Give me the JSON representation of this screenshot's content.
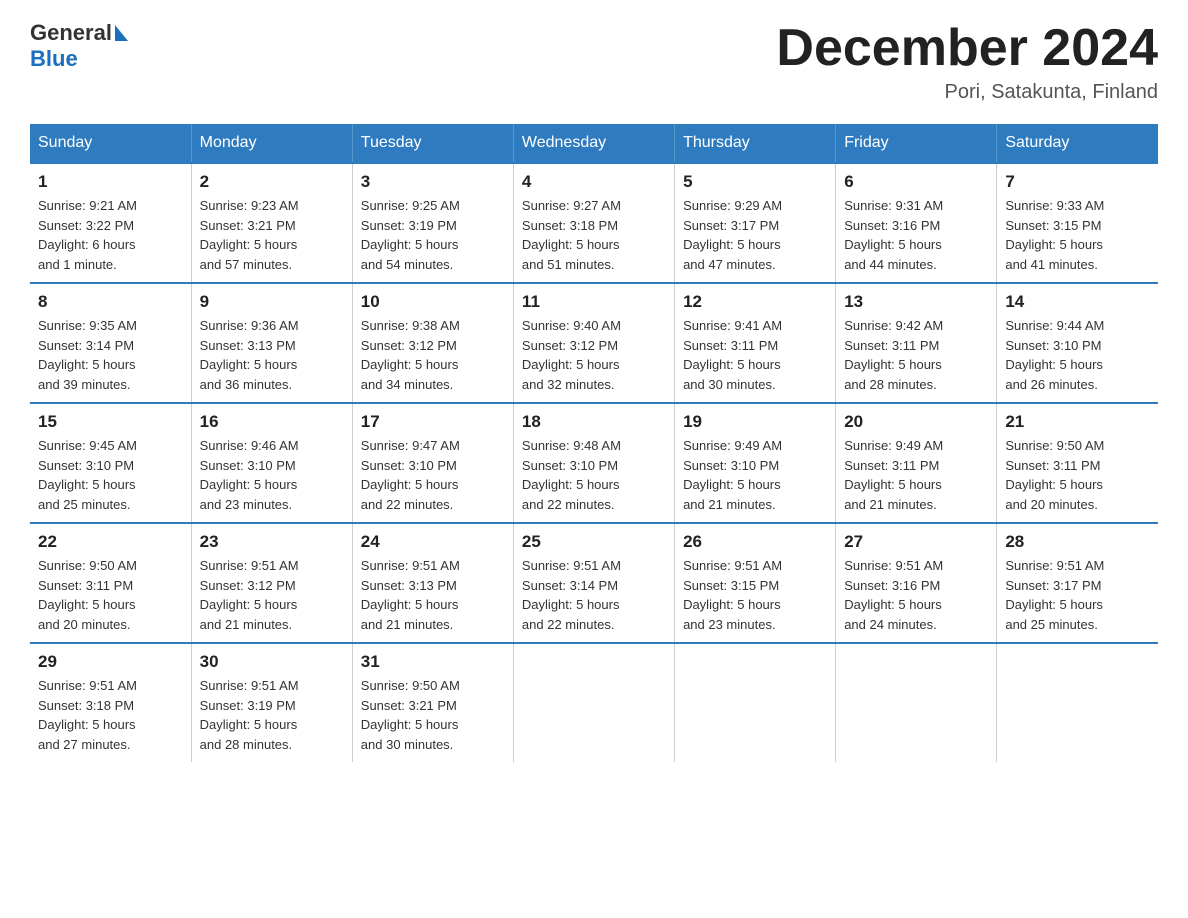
{
  "header": {
    "title": "December 2024",
    "location": "Pori, Satakunta, Finland",
    "logo_general": "General",
    "logo_blue": "Blue"
  },
  "days_of_week": [
    "Sunday",
    "Monday",
    "Tuesday",
    "Wednesday",
    "Thursday",
    "Friday",
    "Saturday"
  ],
  "weeks": [
    [
      {
        "day": "1",
        "info": "Sunrise: 9:21 AM\nSunset: 3:22 PM\nDaylight: 6 hours\nand 1 minute."
      },
      {
        "day": "2",
        "info": "Sunrise: 9:23 AM\nSunset: 3:21 PM\nDaylight: 5 hours\nand 57 minutes."
      },
      {
        "day": "3",
        "info": "Sunrise: 9:25 AM\nSunset: 3:19 PM\nDaylight: 5 hours\nand 54 minutes."
      },
      {
        "day": "4",
        "info": "Sunrise: 9:27 AM\nSunset: 3:18 PM\nDaylight: 5 hours\nand 51 minutes."
      },
      {
        "day": "5",
        "info": "Sunrise: 9:29 AM\nSunset: 3:17 PM\nDaylight: 5 hours\nand 47 minutes."
      },
      {
        "day": "6",
        "info": "Sunrise: 9:31 AM\nSunset: 3:16 PM\nDaylight: 5 hours\nand 44 minutes."
      },
      {
        "day": "7",
        "info": "Sunrise: 9:33 AM\nSunset: 3:15 PM\nDaylight: 5 hours\nand 41 minutes."
      }
    ],
    [
      {
        "day": "8",
        "info": "Sunrise: 9:35 AM\nSunset: 3:14 PM\nDaylight: 5 hours\nand 39 minutes."
      },
      {
        "day": "9",
        "info": "Sunrise: 9:36 AM\nSunset: 3:13 PM\nDaylight: 5 hours\nand 36 minutes."
      },
      {
        "day": "10",
        "info": "Sunrise: 9:38 AM\nSunset: 3:12 PM\nDaylight: 5 hours\nand 34 minutes."
      },
      {
        "day": "11",
        "info": "Sunrise: 9:40 AM\nSunset: 3:12 PM\nDaylight: 5 hours\nand 32 minutes."
      },
      {
        "day": "12",
        "info": "Sunrise: 9:41 AM\nSunset: 3:11 PM\nDaylight: 5 hours\nand 30 minutes."
      },
      {
        "day": "13",
        "info": "Sunrise: 9:42 AM\nSunset: 3:11 PM\nDaylight: 5 hours\nand 28 minutes."
      },
      {
        "day": "14",
        "info": "Sunrise: 9:44 AM\nSunset: 3:10 PM\nDaylight: 5 hours\nand 26 minutes."
      }
    ],
    [
      {
        "day": "15",
        "info": "Sunrise: 9:45 AM\nSunset: 3:10 PM\nDaylight: 5 hours\nand 25 minutes."
      },
      {
        "day": "16",
        "info": "Sunrise: 9:46 AM\nSunset: 3:10 PM\nDaylight: 5 hours\nand 23 minutes."
      },
      {
        "day": "17",
        "info": "Sunrise: 9:47 AM\nSunset: 3:10 PM\nDaylight: 5 hours\nand 22 minutes."
      },
      {
        "day": "18",
        "info": "Sunrise: 9:48 AM\nSunset: 3:10 PM\nDaylight: 5 hours\nand 22 minutes."
      },
      {
        "day": "19",
        "info": "Sunrise: 9:49 AM\nSunset: 3:10 PM\nDaylight: 5 hours\nand 21 minutes."
      },
      {
        "day": "20",
        "info": "Sunrise: 9:49 AM\nSunset: 3:11 PM\nDaylight: 5 hours\nand 21 minutes."
      },
      {
        "day": "21",
        "info": "Sunrise: 9:50 AM\nSunset: 3:11 PM\nDaylight: 5 hours\nand 20 minutes."
      }
    ],
    [
      {
        "day": "22",
        "info": "Sunrise: 9:50 AM\nSunset: 3:11 PM\nDaylight: 5 hours\nand 20 minutes."
      },
      {
        "day": "23",
        "info": "Sunrise: 9:51 AM\nSunset: 3:12 PM\nDaylight: 5 hours\nand 21 minutes."
      },
      {
        "day": "24",
        "info": "Sunrise: 9:51 AM\nSunset: 3:13 PM\nDaylight: 5 hours\nand 21 minutes."
      },
      {
        "day": "25",
        "info": "Sunrise: 9:51 AM\nSunset: 3:14 PM\nDaylight: 5 hours\nand 22 minutes."
      },
      {
        "day": "26",
        "info": "Sunrise: 9:51 AM\nSunset: 3:15 PM\nDaylight: 5 hours\nand 23 minutes."
      },
      {
        "day": "27",
        "info": "Sunrise: 9:51 AM\nSunset: 3:16 PM\nDaylight: 5 hours\nand 24 minutes."
      },
      {
        "day": "28",
        "info": "Sunrise: 9:51 AM\nSunset: 3:17 PM\nDaylight: 5 hours\nand 25 minutes."
      }
    ],
    [
      {
        "day": "29",
        "info": "Sunrise: 9:51 AM\nSunset: 3:18 PM\nDaylight: 5 hours\nand 27 minutes."
      },
      {
        "day": "30",
        "info": "Sunrise: 9:51 AM\nSunset: 3:19 PM\nDaylight: 5 hours\nand 28 minutes."
      },
      {
        "day": "31",
        "info": "Sunrise: 9:50 AM\nSunset: 3:21 PM\nDaylight: 5 hours\nand 30 minutes."
      },
      {
        "day": "",
        "info": ""
      },
      {
        "day": "",
        "info": ""
      },
      {
        "day": "",
        "info": ""
      },
      {
        "day": "",
        "info": ""
      }
    ]
  ]
}
